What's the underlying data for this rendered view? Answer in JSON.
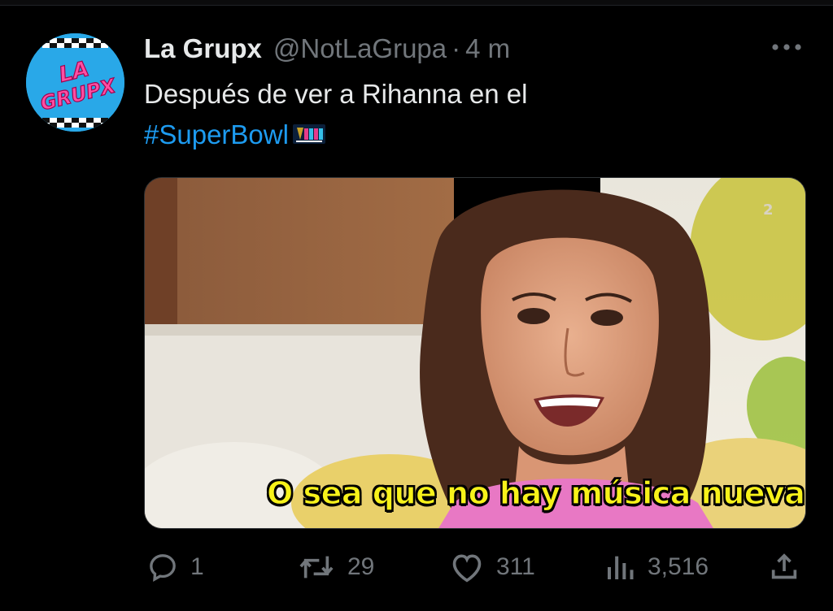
{
  "tweet": {
    "display_name": "La Grupx",
    "handle": "@NotLaGrupa",
    "separator": "·",
    "time": "4 m",
    "text_line1": "Después de ver a Rihanna en el",
    "hashtag": "#SuperBowl",
    "hashflag_icon": "super-bowl-lvii-icon",
    "avatar_logo_text": [
      "LA",
      "GRUPX"
    ]
  },
  "media": {
    "caption": "O sea que no hay música nueva..."
  },
  "actions": {
    "reply_count": "1",
    "retweet_count": "29",
    "like_count": "311",
    "views_count": "3,516"
  },
  "colors": {
    "background": "#000000",
    "text_primary": "#e7e9ea",
    "text_secondary": "#71767b",
    "link": "#1d9bf0",
    "caption": "#f7f21a"
  }
}
